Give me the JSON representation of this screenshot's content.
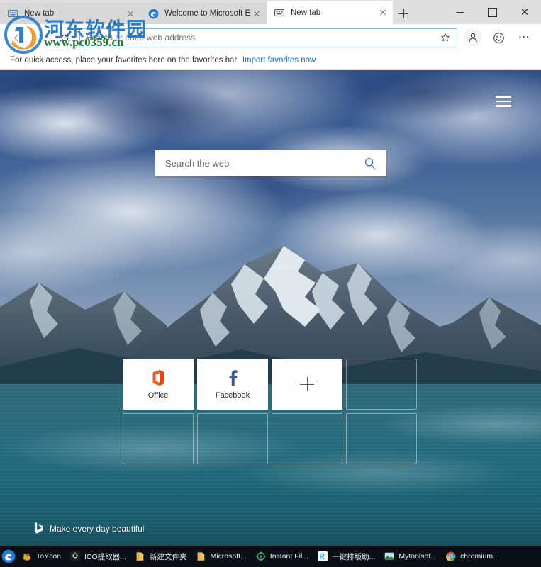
{
  "window": {
    "controls": {
      "minimize": "minimize-button",
      "maximize": "maximize-button",
      "close": "close-button"
    }
  },
  "tabs": [
    {
      "title": "New tab",
      "icon": "newtab-icon",
      "active": false,
      "closable": true
    },
    {
      "title": "Welcome to Microsoft Edge De",
      "icon": "edge-icon",
      "active": false,
      "closable": true
    },
    {
      "title": "New tab",
      "icon": "newtab-icon",
      "active": true,
      "closable": true
    }
  ],
  "new_tab_button_label": "+",
  "toolbar": {
    "back_icon": "back-arrow-icon",
    "forward_icon": "forward-arrow-icon",
    "refresh_icon": "refresh-icon",
    "address": {
      "value": "",
      "placeholder": "Search or enter web address"
    },
    "favorite_icon": "star-icon",
    "profile_icon": "person-icon",
    "feedback_icon": "smiley-icon",
    "settings_icon": "ellipsis-icon"
  },
  "favorites_bar": {
    "message": "For quick access, place your favorites here on the favorites bar.",
    "import_link": "Import favorites now"
  },
  "newtab_page": {
    "menu_icon": "hamburger-menu-icon",
    "search": {
      "placeholder": "Search the web",
      "value": "",
      "go_icon": "search-icon"
    },
    "tiles": [
      {
        "label": "Office",
        "icon": "office-icon",
        "type": "site"
      },
      {
        "label": "Facebook",
        "icon": "facebook-icon",
        "type": "site"
      },
      {
        "label": "",
        "icon": "plus-icon",
        "type": "add"
      },
      {
        "label": "",
        "icon": "",
        "type": "empty"
      },
      {
        "label": "",
        "icon": "",
        "type": "empty"
      },
      {
        "label": "",
        "icon": "",
        "type": "empty"
      },
      {
        "label": "",
        "icon": "",
        "type": "empty"
      },
      {
        "label": "",
        "icon": "",
        "type": "empty"
      }
    ],
    "attribution": {
      "text": "Make every day beautiful",
      "icon": "bing-icon"
    }
  },
  "taskbar": {
    "start_icon": "edge-icon",
    "items": [
      {
        "label": "ToYcon",
        "icon": "toycon-icon"
      },
      {
        "label": "ICO提取器...",
        "icon": "ico-extractor-icon"
      },
      {
        "label": "新建文件夹",
        "icon": "folder-icon"
      },
      {
        "label": "Microsoft...",
        "icon": "folder-icon"
      },
      {
        "label": "Instant Fil...",
        "icon": "instant-file-icon"
      },
      {
        "label": "一键排版助...",
        "icon": "typeset-icon"
      },
      {
        "label": "Mytoolsof...",
        "icon": "picture-icon"
      },
      {
        "label": "chromium...",
        "icon": "chromium-icon"
      }
    ]
  },
  "watermark": {
    "site_name": "河东软件园",
    "url": "www.pc0359.cn"
  },
  "colors": {
    "accent_blue": "#0a6cc9",
    "tab_active": "#ffffff",
    "titlebar": "#dfdfdf",
    "taskbar": "#0b1016",
    "office_orange": "#eb3c00",
    "facebook_blue": "#3b5998",
    "lake_teal": "#256b7d",
    "watermark_blue": "#1c72c4",
    "watermark_green": "#1f7a34"
  }
}
